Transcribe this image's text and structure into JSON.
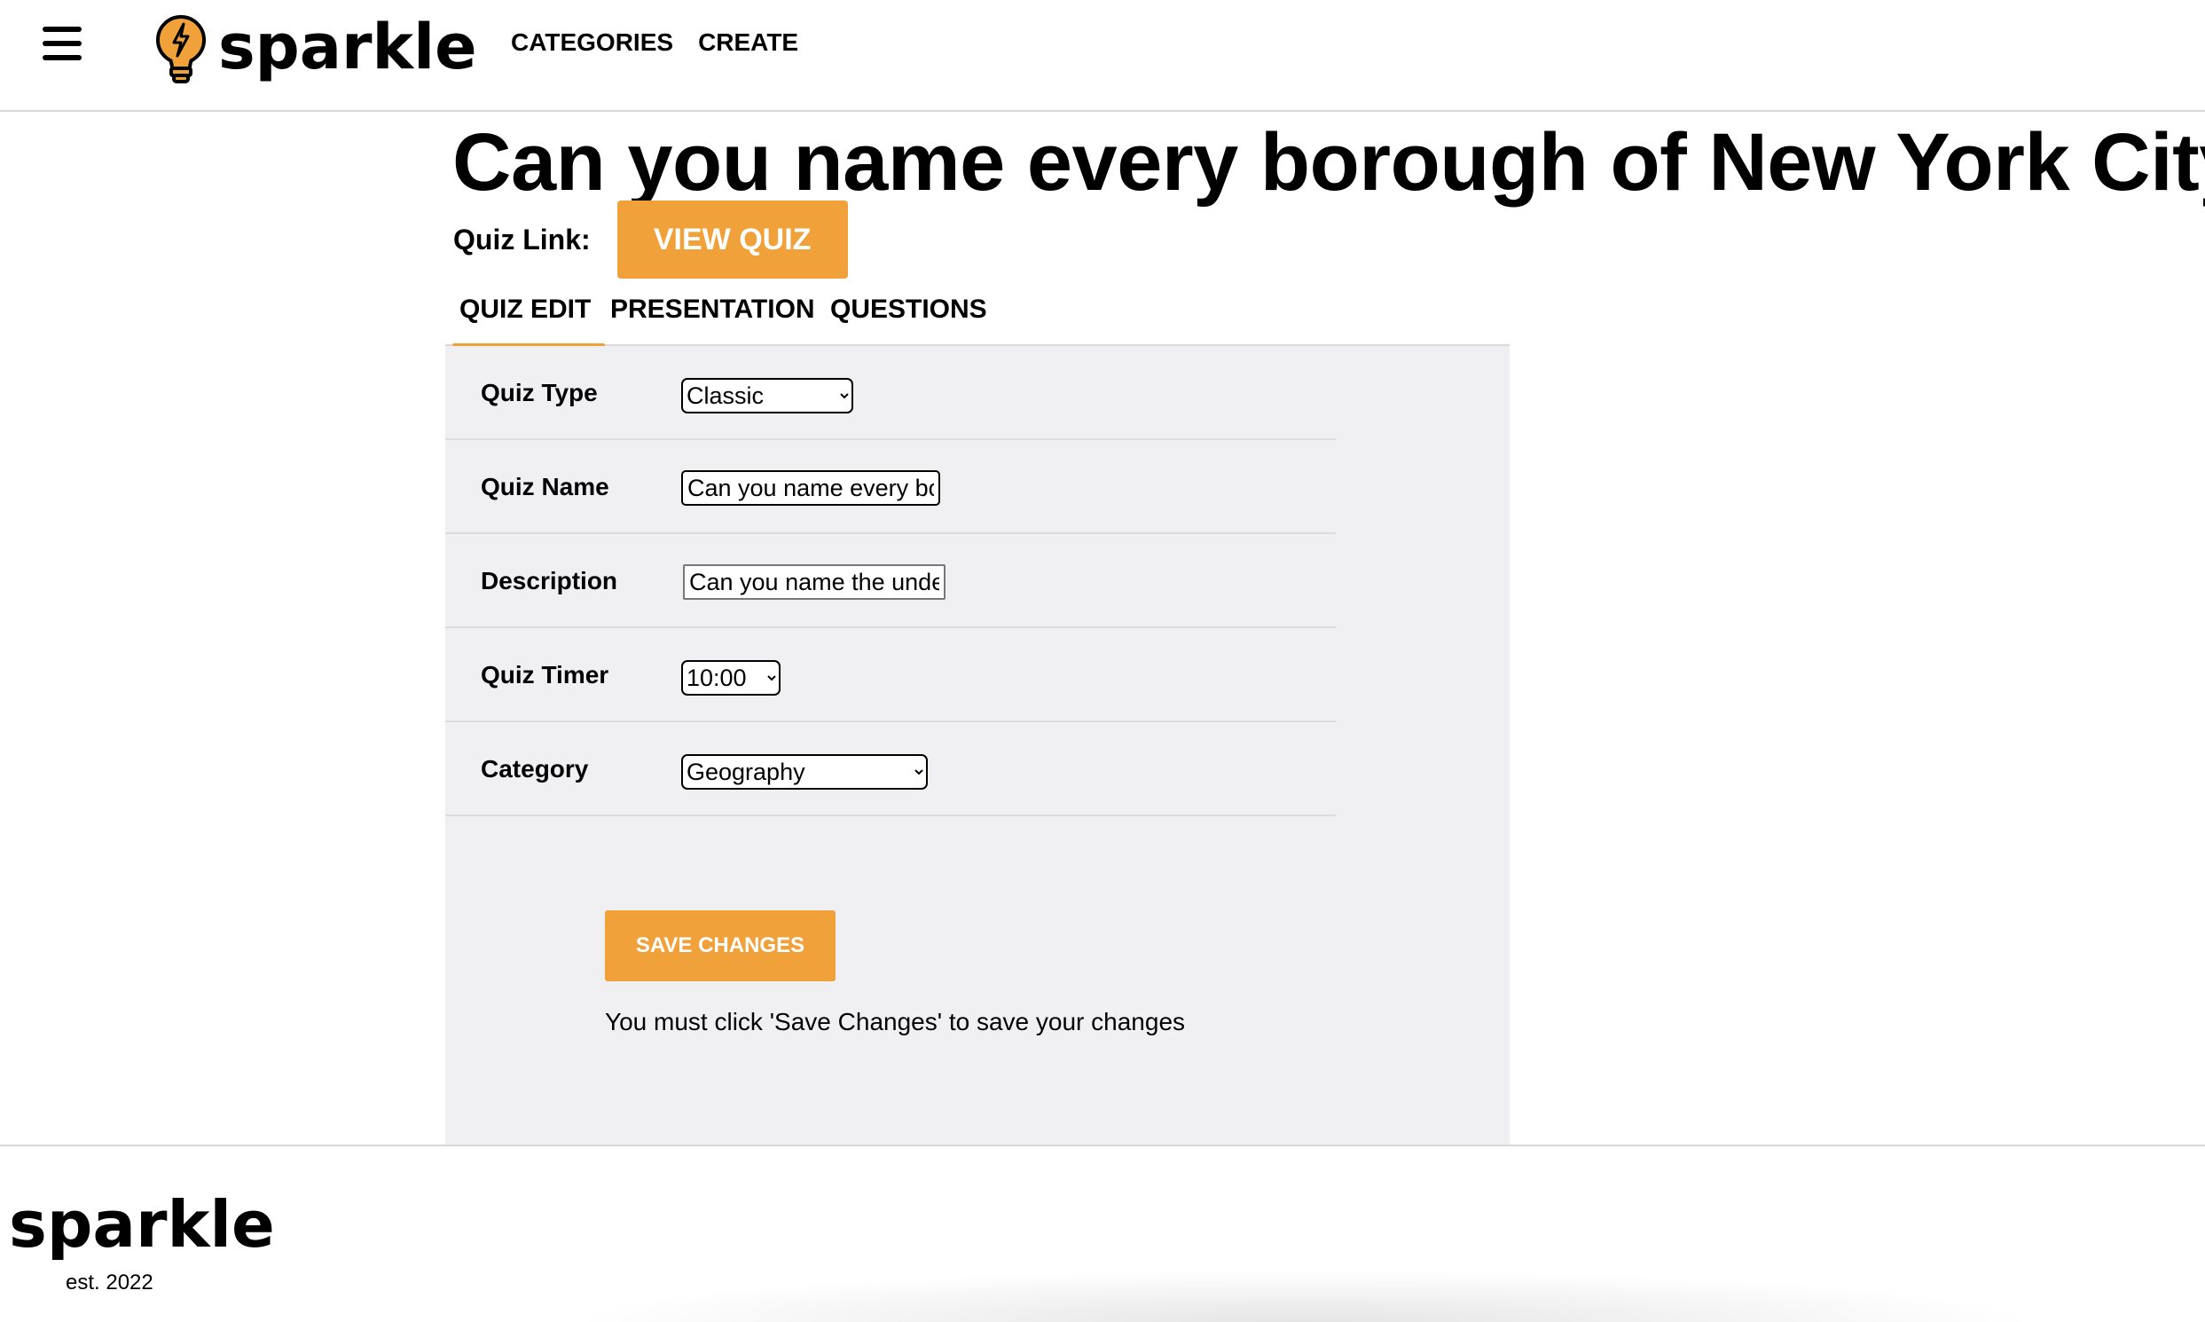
{
  "header": {
    "logo_text": "sparkle",
    "nav": [
      {
        "label": "CATEGORIES"
      },
      {
        "label": "CREATE"
      }
    ]
  },
  "page": {
    "title": "Can you name every borough of New York City?",
    "quiz_link_label": "Quiz Link:",
    "view_quiz_label": "VIEW QUIZ"
  },
  "tabs": [
    {
      "label": "QUIZ EDIT",
      "active": true
    },
    {
      "label": "PRESENTATION",
      "active": false
    },
    {
      "label": "QUESTIONS",
      "active": false
    }
  ],
  "form": {
    "quiz_type": {
      "label": "Quiz Type",
      "value": "Classic"
    },
    "quiz_name": {
      "label": "Quiz Name",
      "value": "Can you name every borough of New York City?"
    },
    "description": {
      "label": "Description",
      "value": "Can you name the underlying boroughs of New York City?"
    },
    "quiz_timer": {
      "label": "Quiz Timer",
      "value": "10:00"
    },
    "category": {
      "label": "Category",
      "value": "Geography"
    },
    "save_label": "SAVE CHANGES",
    "save_note": "You must click 'Save Changes' to save your changes"
  },
  "footer": {
    "logo_text": "sparkle",
    "est": "est. 2022"
  },
  "colors": {
    "accent": "#f0a13a",
    "panel_bg": "#f0f0f2"
  },
  "icons": [
    "hamburger-menu-icon",
    "lightbulb-logo-icon",
    "chevron-down-icon"
  ]
}
